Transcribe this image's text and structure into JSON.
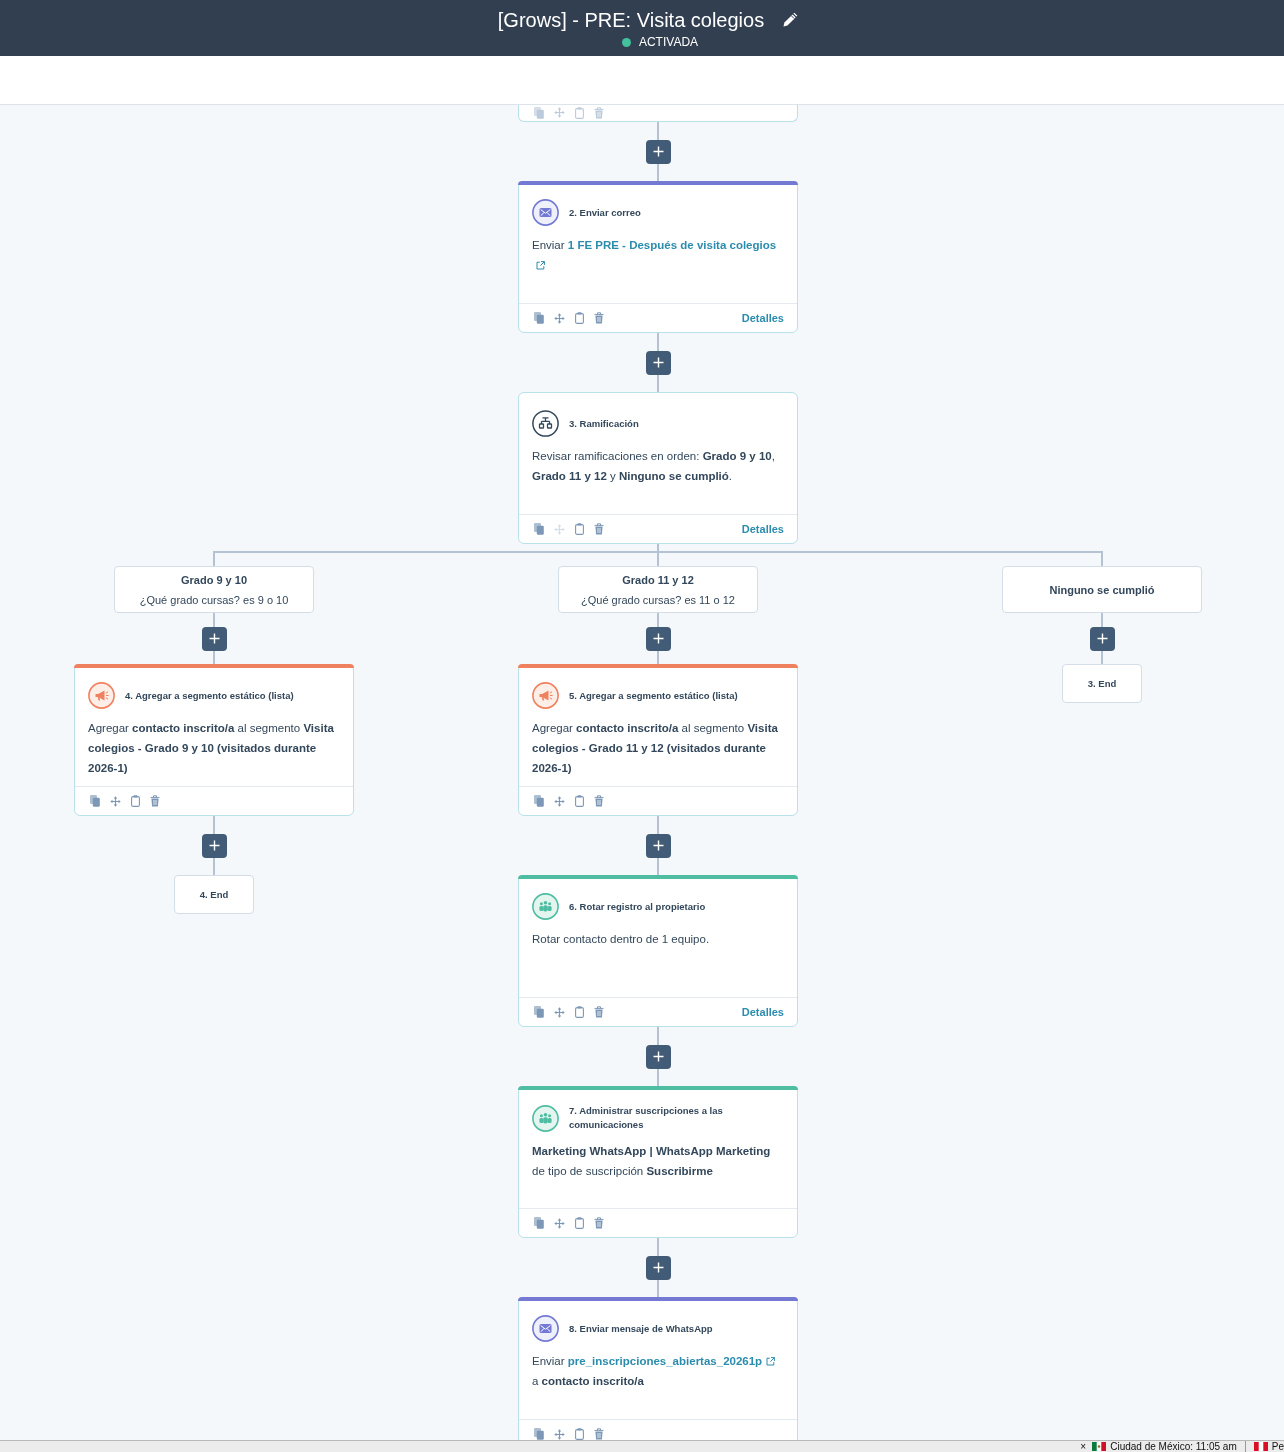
{
  "header": {
    "title": "[Grows] - PRE: Visita colegios",
    "status": {
      "label": "ACTIVADA",
      "active": true
    }
  },
  "workflow": {
    "steps": [
      {
        "kind": "partial",
        "move_disabled": false
      },
      {
        "kind": "message",
        "color": "#7479d4",
        "title": "2. Enviar correo",
        "lead": "Enviar",
        "link": "1 FE PRE - Después de visita colegios",
        "details": "Detalles",
        "move_disabled": false
      },
      {
        "kind": "branch",
        "title": "3. Ramificación",
        "body": "Revisar ramificaciones en orden: **Grado 9 y 10**, **Grado 11 y 12** y **Ninguno se cumplió**.",
        "details": "Detalles",
        "move_disabled": true,
        "children": [
          {
            "kind": "condition",
            "title": "Grado 9 y 10",
            "subtitle": "¿Qué grado cursas? es 9 o 10",
            "children": [
              {
                "kind": "list",
                "color": "#f0815f",
                "title": "4. Agregar a segmento estático (lista)",
                "body": "Agregar **contacto inscrito/a** al segmento **Visita colegios - Grado 9 y 10 (visitados durante 2026-1)**",
                "move_disabled": false
              },
              {
                "kind": "end",
                "title": "4. End"
              }
            ]
          },
          {
            "kind": "condition",
            "title": "Grado 11 y 12",
            "subtitle": "¿Qué grado cursas? es 11 o 12",
            "children": [
              {
                "kind": "list",
                "color": "#f0815f",
                "title": "5. Agregar a segmento estático (lista)",
                "body": "Agregar **contacto inscrito/a** al segmento **Visita colegios - Grado 11 y 12 (visitados durante 2026-1)**",
                "move_disabled": false
              },
              {
                "kind": "crm",
                "color": "#4fbda2",
                "title": "6. Rotar registro al propietario",
                "body": "Rotar contacto dentro de 1 equipo.",
                "details": "Detalles",
                "move_disabled": false
              },
              {
                "kind": "crm",
                "color": "#4fbda2",
                "title": "7. Administrar suscripciones a las comunicaciones",
                "body": "**Marketing WhatsApp | WhatsApp Marketing** de tipo de suscripción **Suscribirme**",
                "move_disabled": false
              },
              {
                "kind": "message",
                "color": "#7479d4",
                "title": "8. Enviar mensaje de WhatsApp",
                "lead": "Enviar",
                "link": "pre_inscripciones_abiertas_20261p",
                "tail": "a **contacto inscrito/a**",
                "move_disabled": false
              }
            ]
          },
          {
            "kind": "condition",
            "title": "Ninguno se cumplió",
            "children": [
              {
                "kind": "end",
                "title": "3. End"
              }
            ]
          }
        ]
      }
    ]
  },
  "status_bar": {
    "close": "×",
    "clocks": [
      {
        "kind": "mexico",
        "label": "Ciudad de México: 11:05 am"
      },
      {
        "kind": "peru",
        "label": "Pe"
      }
    ]
  }
}
